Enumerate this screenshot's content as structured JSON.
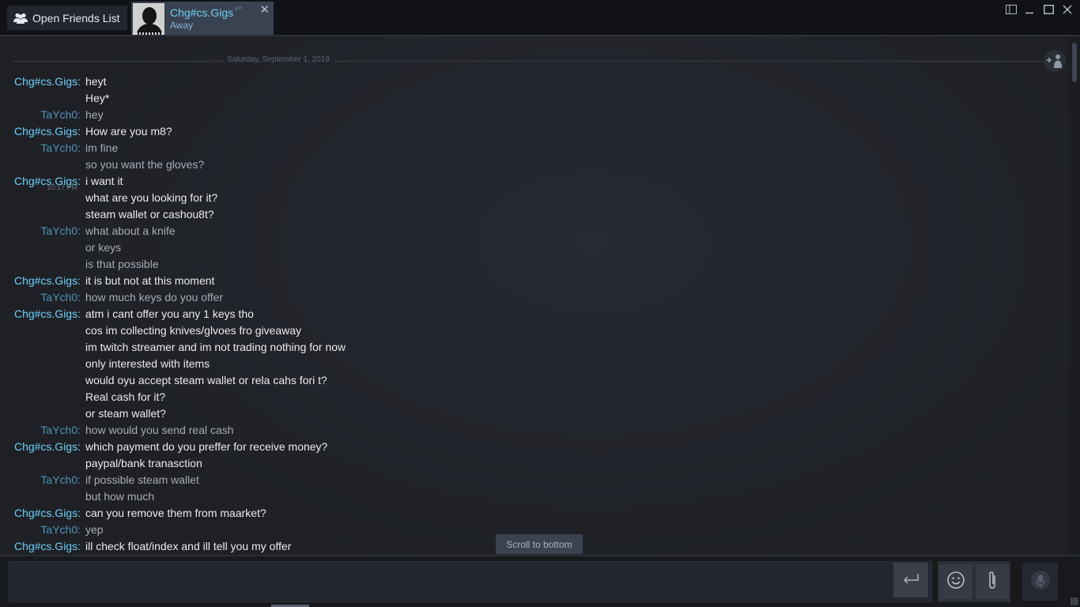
{
  "titlebar": {
    "friends_button_label": "Open Friends List",
    "tab": {
      "name": "Chg#cs.Gigs",
      "status": "Away",
      "away_marker": "zᶻᶻ",
      "close_glyph": "✕"
    }
  },
  "chat": {
    "date": "Saturday, September 1, 2018",
    "messages": [
      {
        "sender": "Chg#cs.Gigs:",
        "text": "heyt",
        "role": "them"
      },
      {
        "sender": "",
        "text": "Hey*",
        "role": "them"
      },
      {
        "sender": "TaYch0:",
        "text": "hey",
        "role": "me"
      },
      {
        "sender": "Chg#cs.Gigs:",
        "text": "How are you m8?",
        "role": "them"
      },
      {
        "sender": "TaYch0:",
        "text": "im fine",
        "role": "me"
      },
      {
        "sender": "",
        "text": "so you want the gloves?",
        "role": "me"
      },
      {
        "sender": "Chg#cs.Gigs:",
        "text": "i want it",
        "role": "them",
        "time": "10:17 PM"
      },
      {
        "sender": "",
        "text": "what are you looking for it?",
        "role": "them"
      },
      {
        "sender": "",
        "text": "steam wallet or cashou8t?",
        "role": "them"
      },
      {
        "sender": "TaYch0:",
        "text": "what about a knife",
        "role": "me"
      },
      {
        "sender": "",
        "text": "or keys",
        "role": "me"
      },
      {
        "sender": "",
        "text": "is that possible",
        "role": "me"
      },
      {
        "sender": "Chg#cs.Gigs:",
        "text": "it is but not at this moment",
        "role": "them"
      },
      {
        "sender": "TaYch0:",
        "text": "how much keys do you offer",
        "role": "me"
      },
      {
        "sender": "Chg#cs.Gigs:",
        "text": "atm i cant offer you any 1 keys tho",
        "role": "them"
      },
      {
        "sender": "",
        "text": "cos im collecting knives/glvoes fro giveaway",
        "role": "them"
      },
      {
        "sender": "",
        "text": "im twitch streamer and im not trading nothing for now",
        "role": "them"
      },
      {
        "sender": "",
        "text": "only interested with items",
        "role": "them"
      },
      {
        "sender": "",
        "text": "would oyu accept steam wallet or rela cahs fori t?",
        "role": "them"
      },
      {
        "sender": "",
        "text": "Real cash for it?",
        "role": "them"
      },
      {
        "sender": "",
        "text": "or steam wallet?",
        "role": "them"
      },
      {
        "sender": "TaYch0:",
        "text": "how would you send real cash",
        "role": "me"
      },
      {
        "sender": "Chg#cs.Gigs:",
        "text": "which payment do you preffer for receive money?",
        "role": "them"
      },
      {
        "sender": "",
        "text": "paypal/bank tranasction",
        "role": "them"
      },
      {
        "sender": "TaYch0:",
        "text": "if possible steam wallet",
        "role": "me"
      },
      {
        "sender": "",
        "text": "but how much",
        "role": "me"
      },
      {
        "sender": "Chg#cs.Gigs:",
        "text": "can you remove them from maarket?",
        "role": "them"
      },
      {
        "sender": "TaYch0:",
        "text": "yep",
        "role": "me"
      },
      {
        "sender": "Chg#cs.Gigs:",
        "text": "ill check float/index and ill tell you my offer",
        "role": "them"
      }
    ],
    "scroll_to_bottom_label": "Scroll to bottom"
  },
  "icons": {
    "friends": "friends-icon",
    "add_friend": "add-friend-icon",
    "send": "enter-icon",
    "emoticon": "smiley-icon",
    "attach": "paperclip-icon",
    "voice": "microphone-icon"
  },
  "colors": {
    "them_name": "#6dcff6",
    "me_name": "#4f93b8",
    "them_text": "#ebebeb",
    "me_text": "#a7adb5",
    "background": "#1f2126"
  }
}
